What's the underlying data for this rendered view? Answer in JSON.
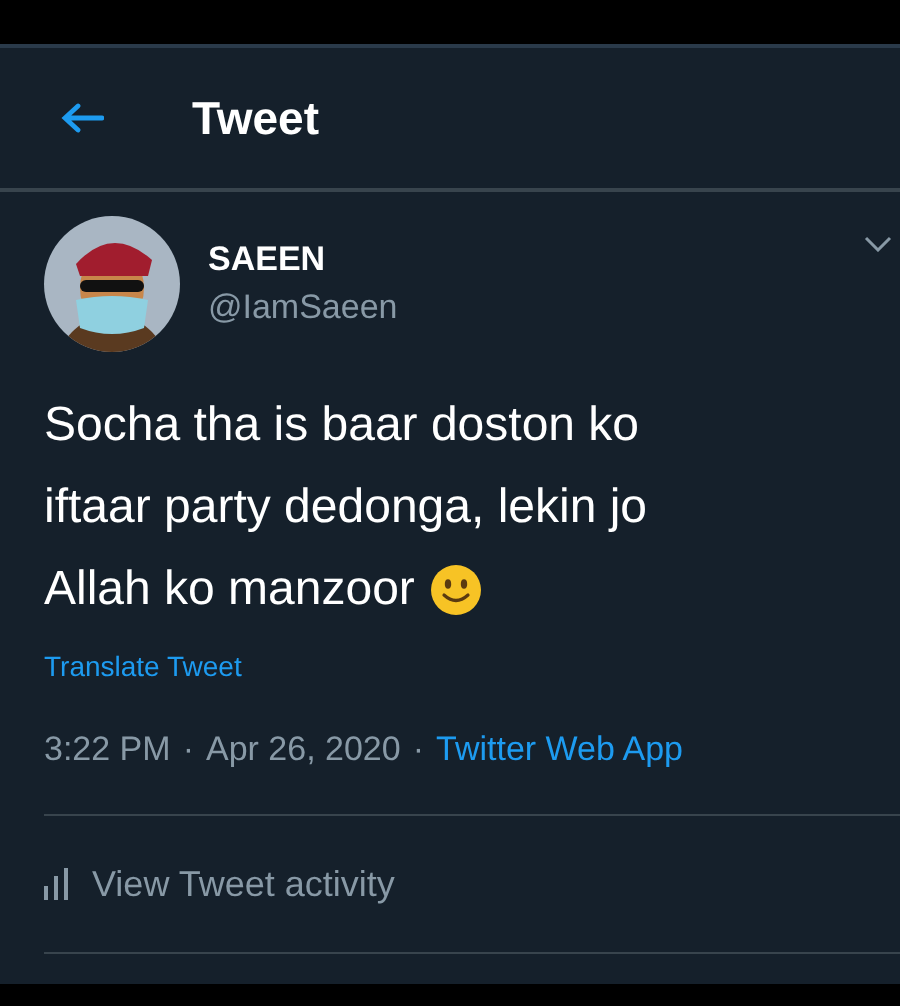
{
  "header": {
    "title": "Tweet"
  },
  "author": {
    "name": "SAEEN",
    "handle": "@IamSaeen"
  },
  "tweet": {
    "lines": [
      "Socha tha is baar doston ko",
      "iftaar party dedonga, lekin jo",
      "Allah ko manzoor"
    ]
  },
  "translate_link": "Translate Tweet",
  "meta": {
    "time": "3:22 PM",
    "separator_1": "·",
    "date": "Apr 26, 2020",
    "separator_2": "·",
    "source": "Twitter Web App"
  },
  "activity_link": "View Tweet activity"
}
